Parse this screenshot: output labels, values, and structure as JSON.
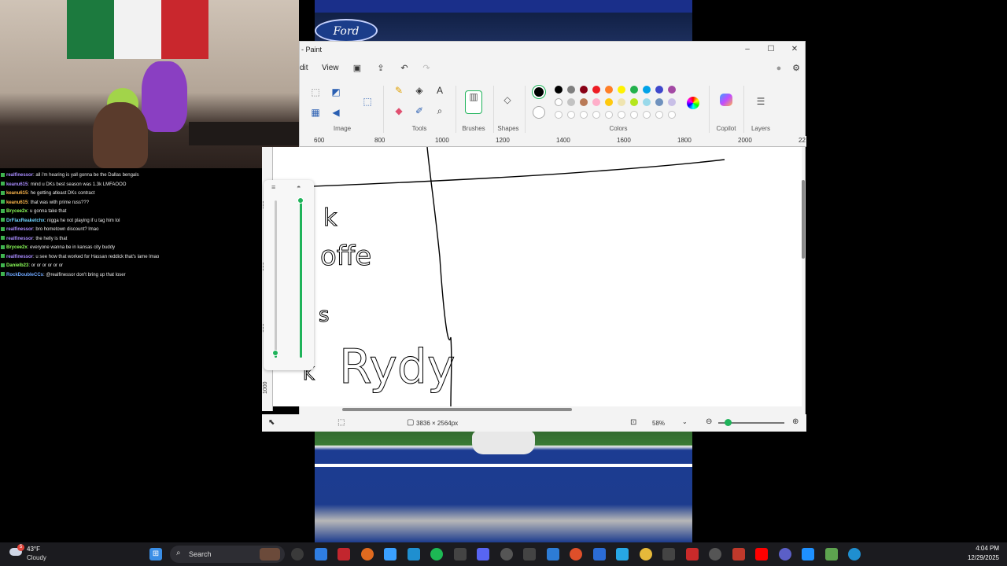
{
  "stadium": {
    "banner": "",
    "logo_text": "Ford"
  },
  "chat": [
    {
      "user": "realfinessor",
      "color": "#a98cff",
      "msg": ": all i'm hearing is yall gonna be the Dallas bengals"
    },
    {
      "user": "keanu615",
      "color": "#a98cff",
      "msg": ": mind u DKs best season was 1.3k LMFAOOO"
    },
    {
      "user": "keanu615",
      "color": "#ffb84d",
      "msg": ": he getting atleast DKs contract"
    },
    {
      "user": "keanu615",
      "color": "#ffb84d",
      "msg": ": that was with prime russ???"
    },
    {
      "user": "Brycee2x",
      "color": "#8cff5a",
      "msg": ": u gonna take that"
    },
    {
      "user": "DrFlaxReaketchx",
      "color": "#6fd4ff",
      "msg": ": nigga he not playing if u tag him lol"
    },
    {
      "user": "realfinessor",
      "color": "#a98cff",
      "msg": ": bro hometown discount? lmao"
    },
    {
      "user": "realfinessor",
      "color": "#a98cff",
      "msg": ": the helly is that"
    },
    {
      "user": "Brycee2x",
      "color": "#8cff5a",
      "msg": ": everyone wanna be in kansas city buddy"
    },
    {
      "user": "realfinessor",
      "color": "#a98cff",
      "msg": ": u see how that worked for Hassan reddick that's lame lmao"
    },
    {
      "user": "Danielb23",
      "color": "#8cff5a",
      "msg": ": or or or or or or"
    },
    {
      "user": "RockDoubleCCs",
      "color": "#6fa8ff",
      "msg": ": @realfinessor don't bring up that loser"
    }
  ],
  "paint": {
    "title": "- Paint",
    "menu": {
      "edit": "dit",
      "view": "View"
    },
    "ribbon": {
      "image": "Image",
      "tools": "Tools",
      "brushes": "Brushes",
      "shapes": "Shapes",
      "colors": "Colors",
      "copilot": "Copilot",
      "layers": "Layers"
    },
    "ruler_top": [
      "600",
      "800",
      "1000",
      "1200",
      "1400",
      "1600",
      "1800",
      "2000",
      "22"
    ],
    "ruler_left": [
      "400",
      "600",
      "800",
      "1000"
    ],
    "canvas_text": {
      "line1": "k",
      "line2": "offe",
      "line3": "s",
      "line4": "Rydy",
      "line5": "K"
    },
    "status": {
      "dimensions": "3836 × 2564px",
      "zoom": "58%"
    },
    "zoom_level": 0.42,
    "size_slider": 0.03,
    "opacity_slider": 1.0,
    "colors": {
      "row1": [
        "#000000",
        "#7f7f7f",
        "#880015",
        "#ed1c24",
        "#ff7f27",
        "#fff200",
        "#22b14c",
        "#00a2e8",
        "#3f48cc",
        "#a349a4"
      ],
      "row2": [
        "#ffffff",
        "#c3c3c3",
        "#b97a57",
        "#ffaec9",
        "#ffc90e",
        "#efe4b0",
        "#b5e61d",
        "#99d9ea",
        "#7092be",
        "#c8bfe7"
      ]
    }
  },
  "taskbar": {
    "weather_temp": "43°F",
    "weather_desc": "Cloudy",
    "weather_badge": "5",
    "search_placeholder": "Search",
    "time": "4:04 PM",
    "date": "12/29/2025"
  }
}
